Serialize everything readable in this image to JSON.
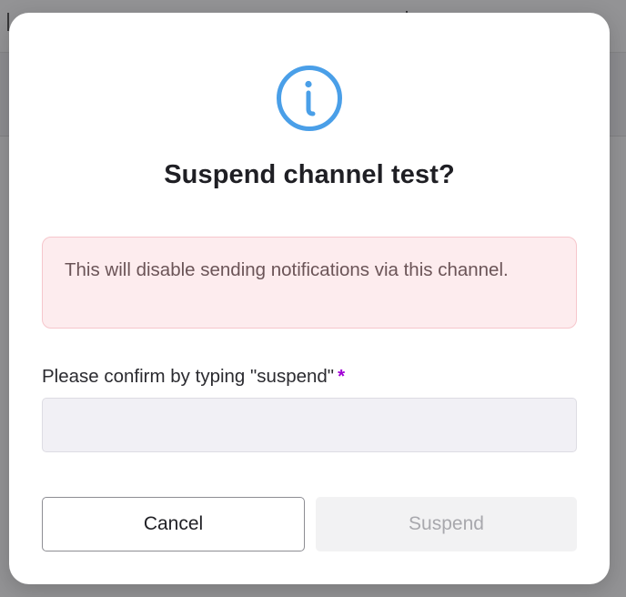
{
  "modal": {
    "title": "Suspend channel test?",
    "alert_text": "This will disable sending notifications via this channel.",
    "confirm_label": "Please confirm by typing \"suspend\"",
    "required_marker": "*",
    "confirm_input": {
      "value": "",
      "placeholder": ""
    },
    "cancel_label": "Cancel",
    "suspend_label": "Suspend",
    "icon": "info-circle-icon"
  },
  "colors": {
    "info_icon": "#4a9fe8",
    "alert_background": "#fdecee",
    "alert_border": "#f6c6cc",
    "required_star": "#a100d6",
    "disabled_button": "#f2f2f3"
  }
}
